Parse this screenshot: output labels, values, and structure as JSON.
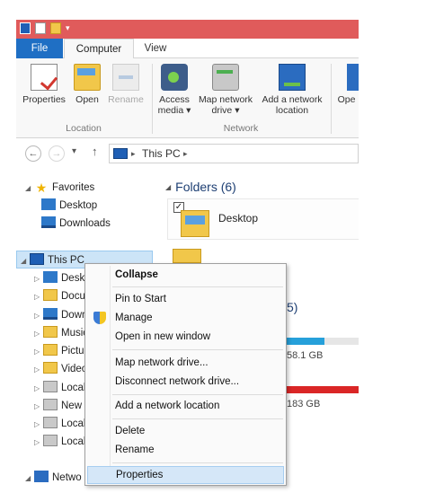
{
  "ribbon": {
    "tabs": {
      "file": "File",
      "computer": "Computer",
      "view": "View"
    },
    "buttons": {
      "properties": "Properties",
      "open": "Open",
      "rename": "Rename",
      "access_media": "Access\nmedia ▾",
      "map_network_drive": "Map network\ndrive ▾",
      "add_network_location": "Add a network\nlocation",
      "open_truncated": "Ope"
    },
    "groups": {
      "location": "Location",
      "network": "Network"
    }
  },
  "address_bar": {
    "crumb": "This PC",
    "sep1": "▸",
    "sep2": "▸"
  },
  "nav_pane": {
    "favorites": "Favorites",
    "desktop": "Desktop",
    "downloads": "Downloads",
    "this_pc": "This PC",
    "children": [
      "Deskt",
      "Docu",
      "Down",
      "Music",
      "Pictu",
      "Video",
      "Local",
      "New",
      "Local",
      "Local"
    ],
    "network": "Netwo"
  },
  "content": {
    "folders_header": "Folders (6)",
    "desktop_tile": "Desktop",
    "drives_count": "5)",
    "drive1_size": "58.1 GB",
    "drive2_size": "183 GB"
  },
  "context_menu": {
    "collapse": "Collapse",
    "pin_to_start": "Pin to Start",
    "manage": "Manage",
    "open_new_window": "Open in new window",
    "map_network_drive": "Map network drive...",
    "disconnect_network_drive": "Disconnect network drive...",
    "add_network_location": "Add a network location",
    "delete": "Delete",
    "rename": "Rename",
    "properties": "Properties"
  },
  "colors": {
    "title_bar": "#e05b5b",
    "file_tab": "#1f6fc4",
    "selection": "#cce4f7",
    "drive_bar_blue": "#26a0da",
    "drive_bar_red": "#da2626"
  }
}
